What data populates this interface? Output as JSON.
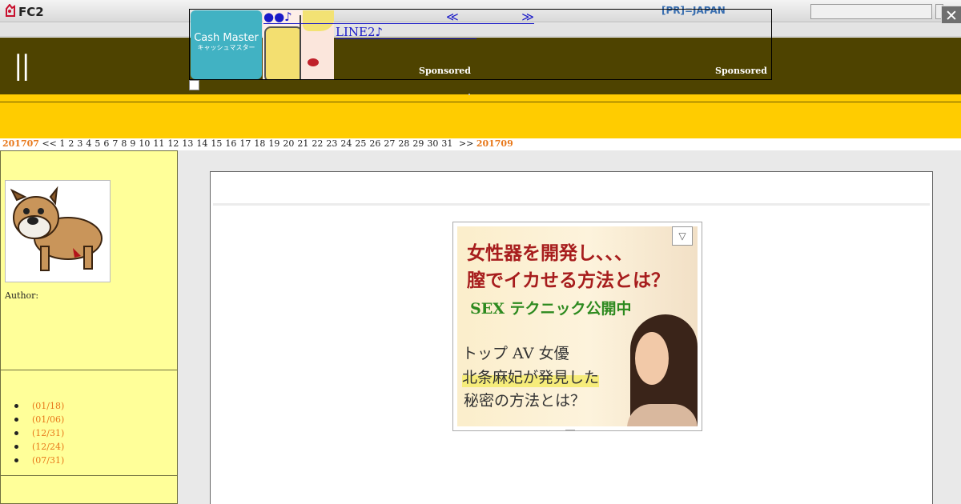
{
  "topbar": {
    "logo_text": "FC2",
    "pr_link": "[PR]=JAPAN",
    "search_placeholder": "",
    "close_label": "✕"
  },
  "header": {
    "title": "||"
  },
  "ad": {
    "logo_line1": "Cash Master",
    "logo_line2": "キャッシュマスター",
    "link1": "●●♪",
    "link2": "LINE2♪",
    "nav_prev": "≪",
    "nav_next": "≫",
    "sponsored_1": "Sponsored",
    "sponsored_2": "Sponsored"
  },
  "calendar": {
    "prev_month": "201707",
    "prev_nav": "<<",
    "days": [
      "1",
      "2",
      "3",
      "4",
      "5",
      "6",
      "7",
      "8",
      "9",
      "10",
      "11",
      "12",
      "13",
      "14",
      "15",
      "16",
      "17",
      "18",
      "19",
      "20",
      "21",
      "22",
      "23",
      "24",
      "25",
      "26",
      "27",
      "28",
      "29",
      "30",
      "31"
    ],
    "next_nav": ">>",
    "next_month": "201709"
  },
  "sidebar": {
    "author_label": "Author:",
    "entries": [
      "(01/18)",
      "(01/06)",
      "(12/31)",
      "(12/24)",
      "(07/31)"
    ]
  },
  "banner": {
    "line1": "女性器を開発し、、、",
    "line2": "膣でイカせる方法とは？",
    "line3": "SEX テクニック公開中",
    "line4": "トップ AV 女優",
    "line5": "北条麻妃が発見した",
    "line6": "秘密の方法とは？",
    "adchoice_icon": "▽"
  },
  "colors": {
    "header_bg": "#4e4300",
    "yellow_band": "#ffcc00",
    "sidebar_bg": "#ffff99",
    "month_link": "#e8781a",
    "ad_link": "#1a1ac8"
  }
}
